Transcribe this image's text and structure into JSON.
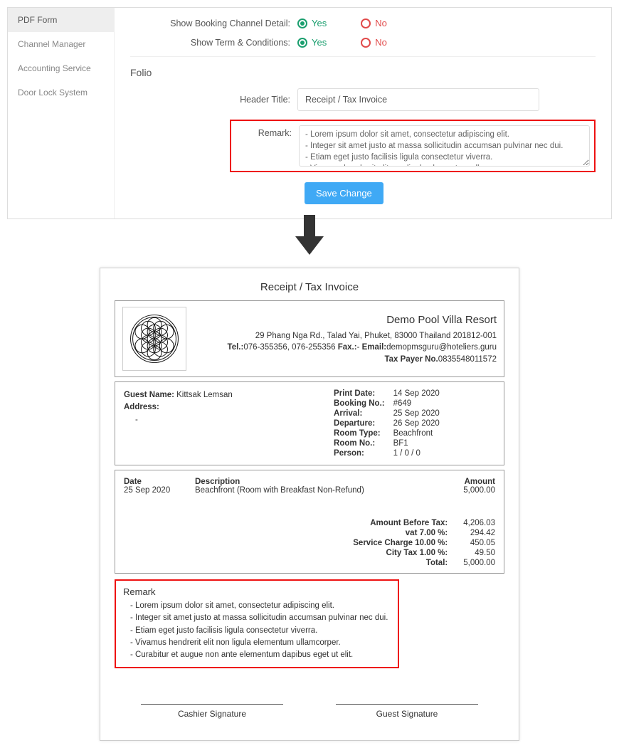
{
  "sidebar": {
    "items": [
      {
        "label": "PDF Form"
      },
      {
        "label": "Channel Manager"
      },
      {
        "label": "Accounting Service"
      },
      {
        "label": "Door Lock System"
      }
    ]
  },
  "form": {
    "booking_channel_label": "Show Booking Channel Detail:",
    "terms_label": "Show Term & Conditions:",
    "yes": "Yes",
    "no": "No",
    "folio_section": "Folio",
    "header_title_label": "Header Title:",
    "header_title_value": "Receipt / Tax Invoice",
    "remark_label": "Remark:",
    "remark_value": "- Lorem ipsum dolor sit amet, consectetur adipiscing elit.\n- Integer sit amet justo at massa sollicitudin accumsan pulvinar nec dui.\n- Etiam eget justo facilisis ligula consectetur viverra.\n- Vivamus hendrerit elit non ligula elementum ullamcorper.",
    "save": "Save Change"
  },
  "invoice": {
    "title": "Receipt / Tax Invoice",
    "company": "Demo Pool Villa Resort",
    "address": "29 Phang Nga Rd., Talad Yai, Phuket, 83000 Thailand 201812-001",
    "tel_label": "Tel.:",
    "tel": "076-355356, 076-255356",
    "fax_label": "Fax.:",
    "fax": "-",
    "email_label": "Email:",
    "email": "demopmsguru@hoteliers.guru",
    "taxpayer_label": "Tax Payer No.",
    "taxpayer": "0835548011572",
    "guest_name_label": "Guest Name:",
    "guest_name": "Kittsak Lemsan",
    "guest_address_label": "Address:",
    "guest_address": "-",
    "details": {
      "print_date_k": "Print Date:",
      "print_date_v": "14 Sep 2020",
      "booking_no_k": "Booking No.:",
      "booking_no_v": "#649",
      "arrival_k": "Arrival:",
      "arrival_v": "25 Sep 2020",
      "departure_k": "Departure:",
      "departure_v": "26 Sep 2020",
      "room_type_k": "Room Type:",
      "room_type_v": "Beachfront",
      "room_no_k": "Room No.:",
      "room_no_v": "BF1",
      "person_k": "Person:",
      "person_v": "1 / 0 / 0"
    },
    "columns": {
      "date": "Date",
      "desc": "Description",
      "amount": "Amount"
    },
    "line": {
      "date": "25 Sep 2020",
      "desc": "Beachfront (Room with Breakfast Non-Refund)",
      "amount": "5,000.00"
    },
    "totals": {
      "before_tax_k": "Amount Before Tax:",
      "before_tax_v": "4,206.03",
      "vat_k": "vat 7.00 %:",
      "vat_v": "294.42",
      "service_k": "Service Charge 10.00 %:",
      "service_v": "450.05",
      "city_k": "City Tax 1.00 %:",
      "city_v": "49.50",
      "total_k": "Total:",
      "total_v": "5,000.00"
    },
    "remark": {
      "title": "Remark",
      "lines": [
        "- Lorem ipsum dolor sit amet, consectetur adipiscing elit.",
        "- Integer sit amet justo at massa sollicitudin accumsan pulvinar nec dui.",
        "- Etiam eget justo facilisis ligula consectetur viverra.",
        "- Vivamus hendrerit elit non ligula elementum ullamcorper.",
        "- Curabitur et augue non ante elementum dapibus eget ut elit."
      ]
    },
    "sig_cashier": "Cashier Signature",
    "sig_guest": "Guest Signature"
  }
}
